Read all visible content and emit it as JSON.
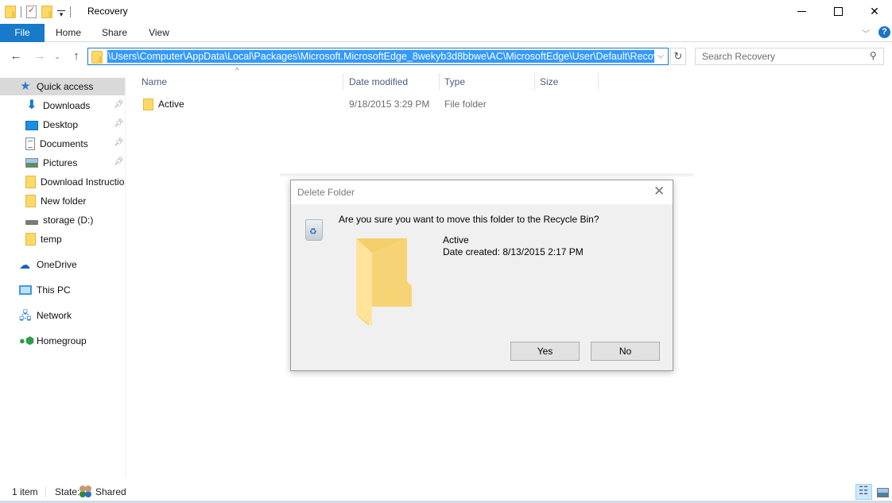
{
  "window": {
    "title": "Recovery",
    "controls": {
      "minimize": "minimize",
      "maximize": "maximize",
      "close": "close"
    }
  },
  "ribbon": {
    "tabs": [
      {
        "label": "File",
        "active": true
      },
      {
        "label": "Home"
      },
      {
        "label": "Share"
      },
      {
        "label": "View"
      }
    ],
    "help_label": "?",
    "accent_color": "#1979ca"
  },
  "address": {
    "path": "\\Users\\Computer\\AppData\\Local\\Packages\\Microsoft.MicrosoftEdge_8wekyb3d8bbwe\\AC\\MicrosoftEdge\\User\\Default\\Recovery",
    "search_placeholder": "Search Recovery"
  },
  "nav_pane": {
    "quick_access": {
      "label": "Quick access",
      "selected": true
    },
    "pinned": [
      {
        "label": "Downloads",
        "icon": "downloads-icon",
        "pinned": true
      },
      {
        "label": "Desktop",
        "icon": "desktop-icon",
        "pinned": true
      },
      {
        "label": "Documents",
        "icon": "documents-icon",
        "pinned": true
      },
      {
        "label": "Pictures",
        "icon": "pictures-icon",
        "pinned": true
      },
      {
        "label": "Download Instructions",
        "icon": "folder-icon"
      },
      {
        "label": "New folder",
        "icon": "folder-icon"
      },
      {
        "label": "storage (D:)",
        "icon": "drive-icon"
      },
      {
        "label": "temp",
        "icon": "folder-icon"
      }
    ],
    "roots": [
      {
        "label": "OneDrive",
        "icon": "onedrive-icon"
      },
      {
        "label": "This PC",
        "icon": "this-pc-icon"
      },
      {
        "label": "Network",
        "icon": "network-icon"
      },
      {
        "label": "Homegroup",
        "icon": "homegroup-icon"
      }
    ]
  },
  "file_list": {
    "columns": [
      "Name",
      "Date modified",
      "Type",
      "Size"
    ],
    "rows": [
      {
        "name": "Active",
        "date_modified": "9/18/2015 3:29 PM",
        "type": "File folder",
        "size": ""
      }
    ]
  },
  "status_bar": {
    "item_count": "1 item",
    "state_label": "State:",
    "state_value": "Shared"
  },
  "dialog": {
    "title": "Delete Folder",
    "question": "Are you sure you want to move this folder to the Recycle Bin?",
    "item_name": "Active",
    "item_date": "Date created: 8/13/2015 2:17 PM",
    "yes_label": "Yes",
    "no_label": "No"
  }
}
